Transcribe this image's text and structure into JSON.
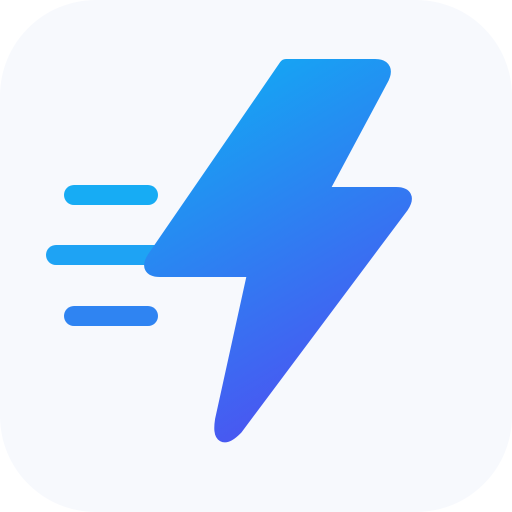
{
  "icon": {
    "name": "lightning-bolt-speed-icon",
    "background_color": "#f7f9fd",
    "gradient_start_color": "#13a8f3",
    "gradient_end_color": "#4f4ef1",
    "speed_lines": 3
  }
}
